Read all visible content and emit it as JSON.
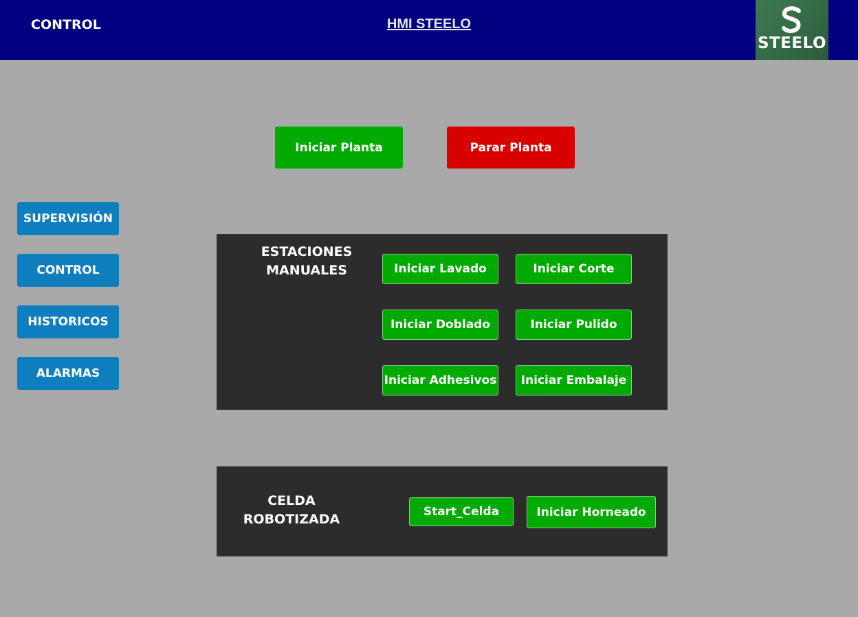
{
  "header": {
    "section_label": "CONTROL",
    "title": "HMI STEELO",
    "logo_text": "STEELO",
    "background_color": "#000080",
    "logo_icon": "steelo-s-logo-icon"
  },
  "plant_controls": {
    "start_label": "Iniciar Planta",
    "stop_label": "Parar Planta",
    "start_color": "#00aa00",
    "stop_color": "#d90000"
  },
  "sidebar": {
    "items": [
      {
        "label": "SUPERVISIÓN"
      },
      {
        "label": "CONTROL"
      },
      {
        "label": "HISTORICOS"
      },
      {
        "label": "ALARMAS"
      }
    ],
    "item_color": "#0f7ebe"
  },
  "manual_stations": {
    "label": "ESTACIONES\nMANUALES",
    "buttons": [
      {
        "label": "Iniciar Lavado"
      },
      {
        "label": "Iniciar Corte"
      },
      {
        "label": "Iniciar Doblado"
      },
      {
        "label": "Iniciar Pulido"
      },
      {
        "label": "Iniciar Adhesivos"
      },
      {
        "label": "Iniciar Embalaje"
      }
    ]
  },
  "robot_cell": {
    "label": "CELDA\nROBOTIZADA",
    "buttons": [
      {
        "label": "Start_Celda"
      },
      {
        "label": "Iniciar Horneado"
      }
    ]
  },
  "colors": {
    "background": "#a9a9a9",
    "panel": "#2c2c2c",
    "station_button": "#00aa00"
  }
}
